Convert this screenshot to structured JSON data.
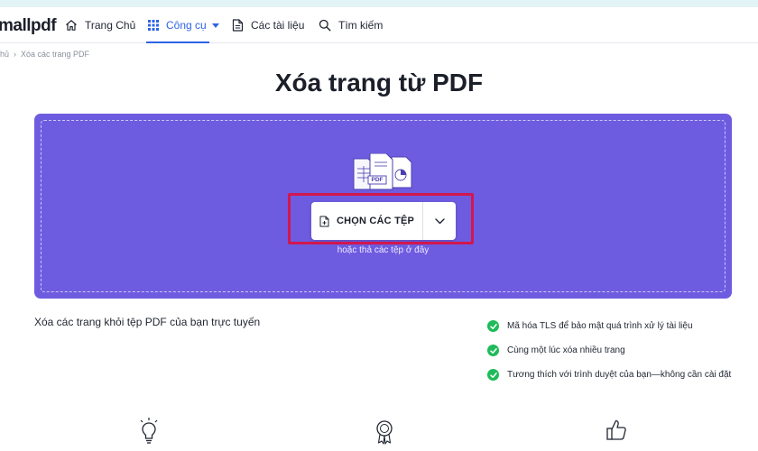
{
  "app": {
    "logo_text": "mallpdf"
  },
  "nav": {
    "home": "Trang Chủ",
    "tools": "Công cụ",
    "documents": "Các tài liệu",
    "search": "Tìm kiếm"
  },
  "breadcrumb": {
    "parent": "hủ",
    "current": "Xóa các trang PDF"
  },
  "page": {
    "title": "Xóa trang từ PDF",
    "description": "Xóa các trang khỏi tệp PDF của bạn trực tuyến"
  },
  "dropzone": {
    "illustration_label": "PDF",
    "choose_button_label": "CHỌN CÁC TỆP",
    "drop_hint": "hoặc thả các tệp ở đây"
  },
  "features": [
    "Mã hóa TLS để bảo mật quá trình xử lý tài liệu",
    "Cùng một lúc xóa nhiều trang",
    "Tương thích với trình duyệt của bạn—không cần cài đặt"
  ],
  "colors": {
    "dropzone": "#6e5ce0",
    "accent": "#2f64e5",
    "highlight": "#d2174d",
    "check": "#1fbb5a"
  }
}
